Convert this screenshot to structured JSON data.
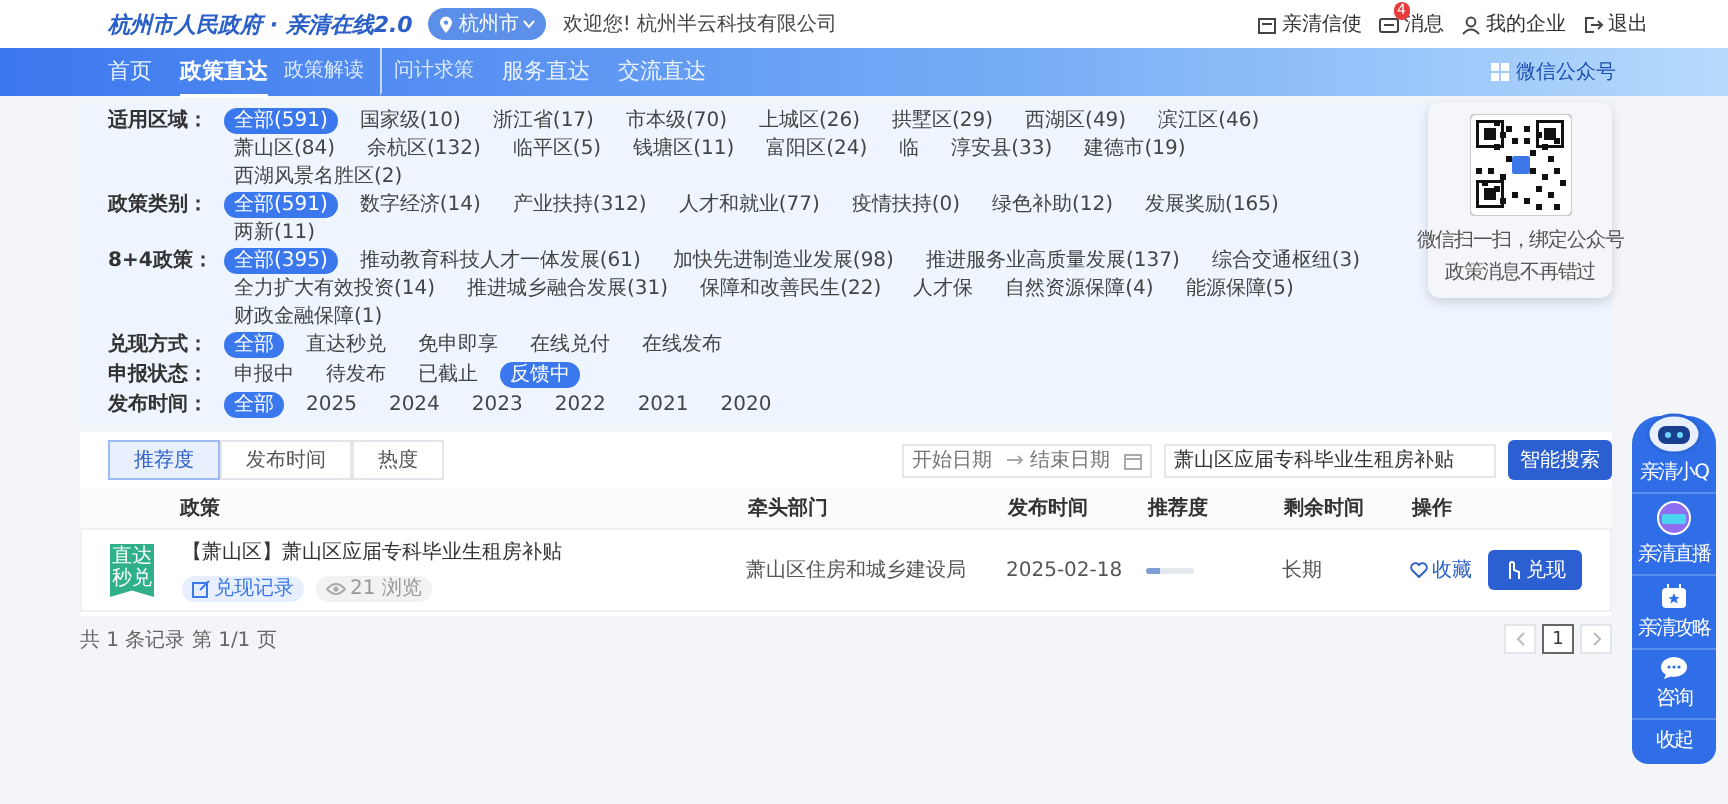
{
  "header": {
    "logo": "杭州市人民政府 · 亲清在线2.0",
    "city": "杭州市",
    "welcome": "欢迎您! 杭州半云科技有限公司",
    "links": [
      {
        "kind": "mail",
        "label": "亲清信使"
      },
      {
        "kind": "message",
        "label": "消息",
        "badge": "4"
      },
      {
        "kind": "company",
        "label": "我的企业"
      },
      {
        "kind": "logout",
        "label": "退出"
      }
    ]
  },
  "nav": {
    "items": [
      {
        "kind": "main",
        "label": "首页",
        "selected": false
      },
      {
        "kind": "main",
        "label": "政策直达",
        "selected": true
      },
      {
        "kind": "sub",
        "label": "政策解读",
        "selected": false
      },
      {
        "kind": "sub",
        "label": "问计求策",
        "selected": false
      },
      {
        "kind": "main",
        "label": "服务直达",
        "selected": false
      },
      {
        "kind": "main",
        "label": "交流直达",
        "selected": false
      }
    ],
    "wechat": "微信公众号"
  },
  "wechat_popup": {
    "lines": [
      "微信扫一扫，绑定公众号",
      "政策消息不再错过"
    ]
  },
  "filters": [
    {
      "label": "适用区域：",
      "options": [
        {
          "label": "全部(591)",
          "selected": true
        },
        {
          "label": "国家级(10)",
          "selected": false
        },
        {
          "label": "浙江省(17)",
          "selected": false
        },
        {
          "label": "市本级(70)",
          "selected": false
        },
        {
          "label": "上城区(26)",
          "selected": false
        },
        {
          "label": "拱墅区(29)",
          "selected": false
        },
        {
          "label": "西湖区(49)",
          "selected": false
        },
        {
          "label": "滨江区(46)",
          "selected": false
        },
        {
          "label": "萧山区(84)",
          "selected": false
        },
        {
          "label": "余杭区(132)",
          "selected": false
        },
        {
          "label": "临平区(5)",
          "selected": false
        },
        {
          "label": "钱塘区(11)",
          "selected": false
        },
        {
          "label": "富阳区(24)",
          "selected": false
        },
        {
          "label": "临",
          "selected": false
        },
        {
          "label": "淳安县(33)",
          "selected": false
        },
        {
          "label": "建德市(19)",
          "selected": false
        },
        {
          "label": "西湖风景名胜区(2)",
          "selected": false
        }
      ]
    },
    {
      "label": "政策类别：",
      "options": [
        {
          "label": "全部(591)",
          "selected": true
        },
        {
          "label": "数字经济(14)",
          "selected": false
        },
        {
          "label": "产业扶持(312)",
          "selected": false
        },
        {
          "label": "人才和就业(77)",
          "selected": false
        },
        {
          "label": "疫情扶持(0)",
          "selected": false
        },
        {
          "label": "绿色补助(12)",
          "selected": false
        },
        {
          "label": "发展奖励(165)",
          "selected": false
        },
        {
          "label": "两新(11)",
          "selected": false
        }
      ]
    },
    {
      "label": "8+4政策：",
      "options": [
        {
          "label": "全部(395)",
          "selected": true
        },
        {
          "label": "推动教育科技人才一体发展(61)",
          "selected": false
        },
        {
          "label": "加快先进制造业发展(98)",
          "selected": false
        },
        {
          "label": "推进服务业高质量发展(137)",
          "selected": false
        },
        {
          "label": "综合交通枢纽(3)",
          "selected": false
        },
        {
          "label": "全力扩大有效投资(14)",
          "selected": false
        },
        {
          "label": "推进城乡融合发展(31)",
          "selected": false
        },
        {
          "label": "保障和改善民生(22)",
          "selected": false
        },
        {
          "label": "人才保",
          "selected": false
        },
        {
          "label": "自然资源保障(4)",
          "selected": false
        },
        {
          "label": "能源保障(5)",
          "selected": false
        },
        {
          "label": "财政金融保障(1)",
          "selected": false
        }
      ]
    },
    {
      "label": "兑现方式：",
      "options": [
        {
          "label": "全部",
          "selected": true
        },
        {
          "label": "直达秒兑",
          "selected": false
        },
        {
          "label": "免申即享",
          "selected": false
        },
        {
          "label": "在线兑付",
          "selected": false
        },
        {
          "label": "在线发布",
          "selected": false
        }
      ]
    },
    {
      "label": "申报状态：",
      "options": [
        {
          "label": "申报中",
          "selected": false
        },
        {
          "label": "待发布",
          "selected": false
        },
        {
          "label": "已截止",
          "selected": false
        },
        {
          "label": "反馈中",
          "selected": true
        }
      ]
    },
    {
      "label": "发布时间：",
      "options": [
        {
          "label": "全部",
          "selected": true
        },
        {
          "label": "2025",
          "selected": false
        },
        {
          "label": "2024",
          "selected": false
        },
        {
          "label": "2023",
          "selected": false
        },
        {
          "label": "2022",
          "selected": false
        },
        {
          "label": "2021",
          "selected": false
        },
        {
          "label": "2020",
          "selected": false
        }
      ]
    }
  ],
  "sort_tabs": [
    {
      "label": "推荐度",
      "selected": true
    },
    {
      "label": "发布时间",
      "selected": false
    },
    {
      "label": "热度",
      "selected": false
    }
  ],
  "date_range": {
    "start_placeholder": "开始日期",
    "end_placeholder": "结束日期"
  },
  "search": {
    "value": "萧山区应届专科毕业生租房补贴",
    "button": "智能搜索"
  },
  "table": {
    "columns": [
      "政策",
      "牵头部门",
      "发布时间",
      "推荐度",
      "剩余时间",
      "操作"
    ],
    "rows": [
      {
        "badge": "直达秒兑",
        "title": "【萧山区】萧山区应届专科毕业生租房补贴",
        "record": "兑现记录",
        "views": "21 浏览",
        "department": "萧山区住房和城乡建设局",
        "date": "2025-02-18",
        "recommend": {
          "level": 0.3
        },
        "remaining": "长期",
        "favorite": "收藏",
        "action": "兑现"
      }
    ]
  },
  "footer": {
    "summary": "共 1 条记录 第 1/1 页",
    "pages": [
      {
        "label": "1",
        "selected": true
      }
    ]
  },
  "dock": [
    {
      "kind": "robot",
      "label": "亲清小Q"
    },
    {
      "kind": "live",
      "label": "亲清直播"
    },
    {
      "kind": "guide",
      "label": "亲清攻略"
    },
    {
      "kind": "chat",
      "label": "咨询"
    },
    {
      "kind": "collapse",
      "label": "收起"
    }
  ]
}
